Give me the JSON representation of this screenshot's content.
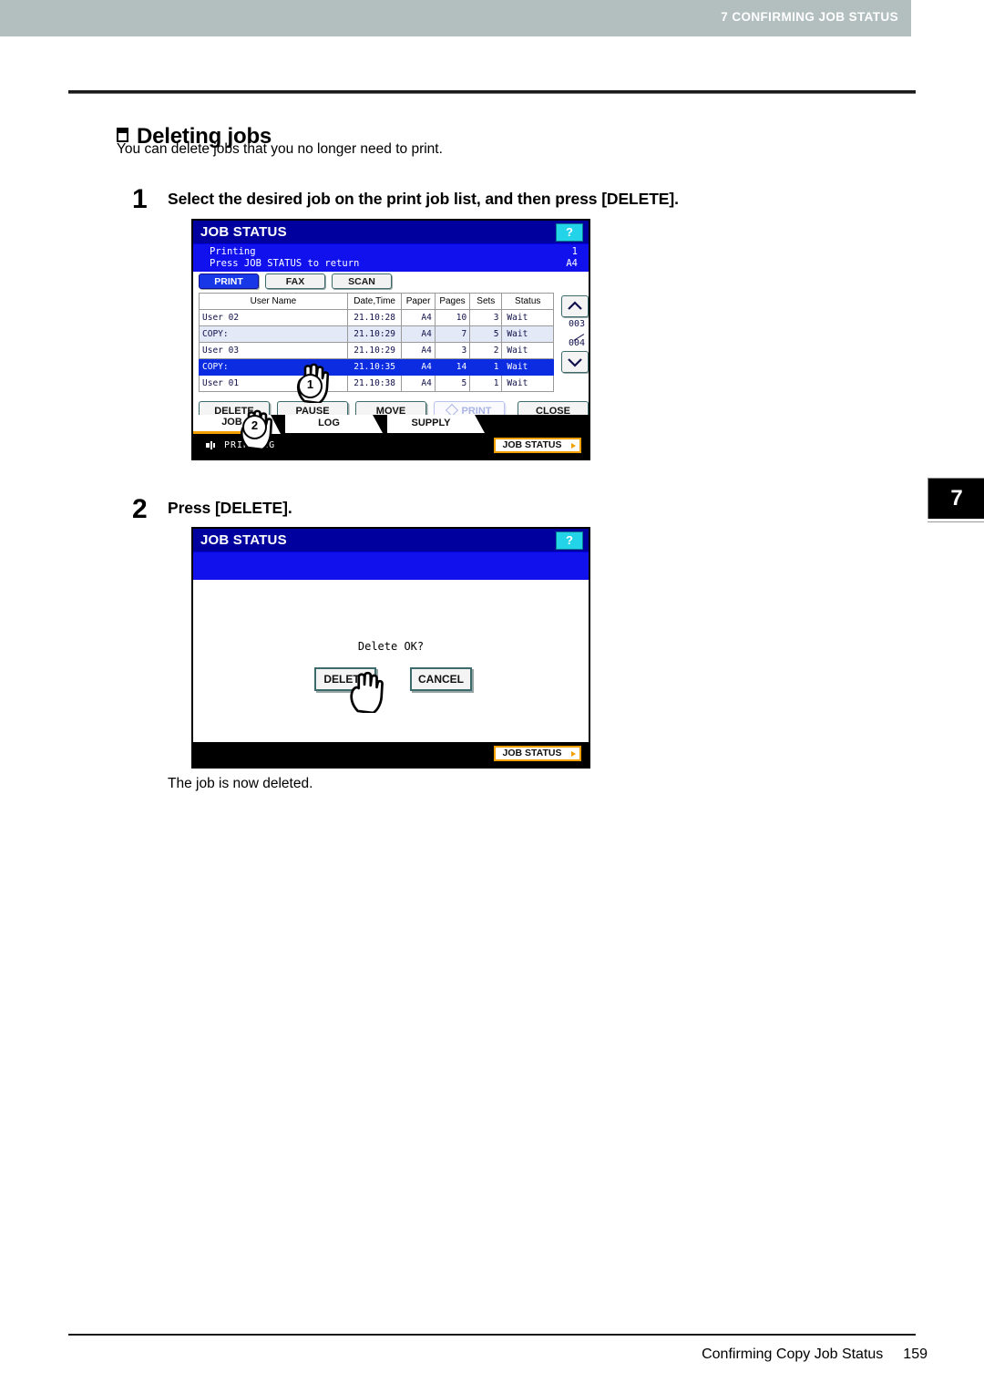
{
  "running_header": {
    "text": "7 CONFIRMING JOB STATUS"
  },
  "chapter_tab": {
    "number": "7"
  },
  "heading": {
    "title": "Deleting jobs"
  },
  "intro": {
    "text": "You can delete jobs that you no longer need to print."
  },
  "steps": [
    {
      "number": "1",
      "title": "Select the desired job on the print job list, and then press [DELETE]."
    },
    {
      "number": "2",
      "title": "Press [DELETE]."
    }
  ],
  "after_note": {
    "text": "The job is now deleted."
  },
  "footer": {
    "section": "Confirming Copy Job Status",
    "page": "159"
  },
  "panel1": {
    "title": "JOB STATUS",
    "help_label": "?",
    "message_line1": "Printing",
    "message_line2": "Press JOB STATUS to return",
    "message_right1": "1",
    "message_right2": "A4",
    "modes": [
      {
        "label": "PRINT",
        "selected": true
      },
      {
        "label": "FAX",
        "selected": false
      },
      {
        "label": "SCAN",
        "selected": false
      }
    ],
    "table": {
      "headers": [
        "User Name",
        "Date,Time",
        "Paper",
        "Pages",
        "Sets",
        "Status"
      ],
      "rows": [
        {
          "user": "User 02",
          "date": "21.10:28",
          "paper": "A4",
          "pages": "10",
          "sets": "3",
          "status": "Wait",
          "style": "plain"
        },
        {
          "user": "COPY:",
          "date": "21.10:29",
          "paper": "A4",
          "pages": "7",
          "sets": "5",
          "status": "Wait",
          "style": "alt"
        },
        {
          "user": "User 03",
          "date": "21.10:29",
          "paper": "A4",
          "pages": "3",
          "sets": "2",
          "status": "Wait",
          "style": "plain"
        },
        {
          "user": "COPY:",
          "date": "21.10:35",
          "paper": "A4",
          "pages": "14",
          "sets": "1",
          "status": "Wait",
          "style": "sel"
        },
        {
          "user": "User 01",
          "date": "21.10:38",
          "paper": "A4",
          "pages": "5",
          "sets": "1",
          "status": "Wait",
          "style": "plain"
        }
      ]
    },
    "scroll": {
      "up_icon": "chevron-up-icon",
      "down_icon": "chevron-down-icon",
      "current": "003",
      "total": "004"
    },
    "actions": [
      {
        "label": "DELETE",
        "disabled": false
      },
      {
        "label": "PAUSE",
        "disabled": false
      },
      {
        "label": "MOVE",
        "disabled": false
      },
      {
        "label": "PRINT",
        "disabled": true
      },
      {
        "label": "CLOSE",
        "disabled": false
      }
    ],
    "tabs": [
      {
        "label": "JOB",
        "active": true
      },
      {
        "label": "LOG",
        "active": false
      },
      {
        "label": "SUPPLY",
        "active": false
      }
    ],
    "status_bar": {
      "text": "PRINTING",
      "job_status_label": "JOB STATUS"
    },
    "callouts": [
      {
        "number": "1"
      },
      {
        "number": "2"
      }
    ]
  },
  "panel2": {
    "title": "JOB STATUS",
    "help_label": "?",
    "dialog_message": "Delete OK?",
    "buttons": [
      {
        "label": "DELETE"
      },
      {
        "label": "CANCEL"
      }
    ],
    "status_bar": {
      "job_status_label": "JOB STATUS"
    }
  },
  "colors": {
    "running_header_bg": "#b3bfbf",
    "lcd_title_bg": "#00009e",
    "lcd_message_bg": "#1111ee",
    "selected_row_bg": "#0b2ce0",
    "alt_row_bg": "#e4e9f7",
    "accent_orange": "#f2a000",
    "help_cyan": "#23d3e8"
  }
}
